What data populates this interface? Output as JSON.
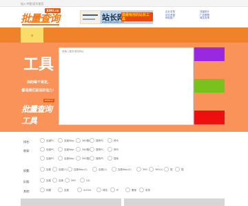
{
  "topbar": {
    "text": "加入书签|设为首页"
  },
  "header": {
    "logo_text": "批量查询工具",
    "logo_tag": "8393.cn",
    "ad_small": {
      "name": "small-ad"
    },
    "ad_banner": {
      "brand": "站长网",
      "slogan": "做最有用的站长工具",
      "url": "www.webmaster.com"
    },
    "links_col1": [
      "企业名录",
      "站长资源",
      "网站推广"
    ],
    "links_col2": [
      "流量统计",
      "广告联盟",
      "域名查询"
    ],
    "links_col3": [
      "友情链接",
      "网站模板",
      "建站服务"
    ]
  },
  "nav": {
    "active_icon": "home-icon",
    "active_glyph": "⌂"
  },
  "hero": {
    "big_text": "工具",
    "line1": "你的每个肯定,",
    "line2": "都是我们前进的动力!",
    "badge_logo": "批量查询工具",
    "badge_tag": "8393.cn",
    "input_placeholder": "请输入要查询的网址",
    "buttons": [
      {
        "name": "query-button",
        "color": "#9a28e0"
      },
      {
        "name": "clear-button",
        "color": "#7ac11e"
      },
      {
        "name": "export-button",
        "color": "#ee1010"
      }
    ]
  },
  "options": {
    "rows": [
      {
        "label": "排名:",
        "items": [
          "百度PC",
          "百度Wap",
          "360搜索",
          "搜狗PC",
          "神马"
        ]
      },
      {
        "label": "收录:",
        "items": [
          "百度PC",
          "百度Wap",
          "360搜索",
          "搜狗PC",
          "神马"
        ]
      },
      {
        "label": "",
        "items": [
          "百度PC",
          "百度Wap",
          "360搜索",
          "搜狗PC",
          "搜索"
        ]
      },
      {
        "label": "权重:",
        "items": [
          "百度",
          "百度(1)",
          "百度Wap(1)",
          "百度(2)",
          "百度Wap(2)",
          "360",
          "360(1)",
          "搜",
          "搜"
        ]
      },
      {
        "label": "反链:",
        "items": [
          "百度",
          "百度",
          "360",
          "QQ"
        ]
      },
      {
        "label": "其他:",
        "items": [
          "标题",
          "百度",
          "ALEXA",
          "域名",
          "IP",
          "备案",
          "收录"
        ]
      }
    ]
  }
}
